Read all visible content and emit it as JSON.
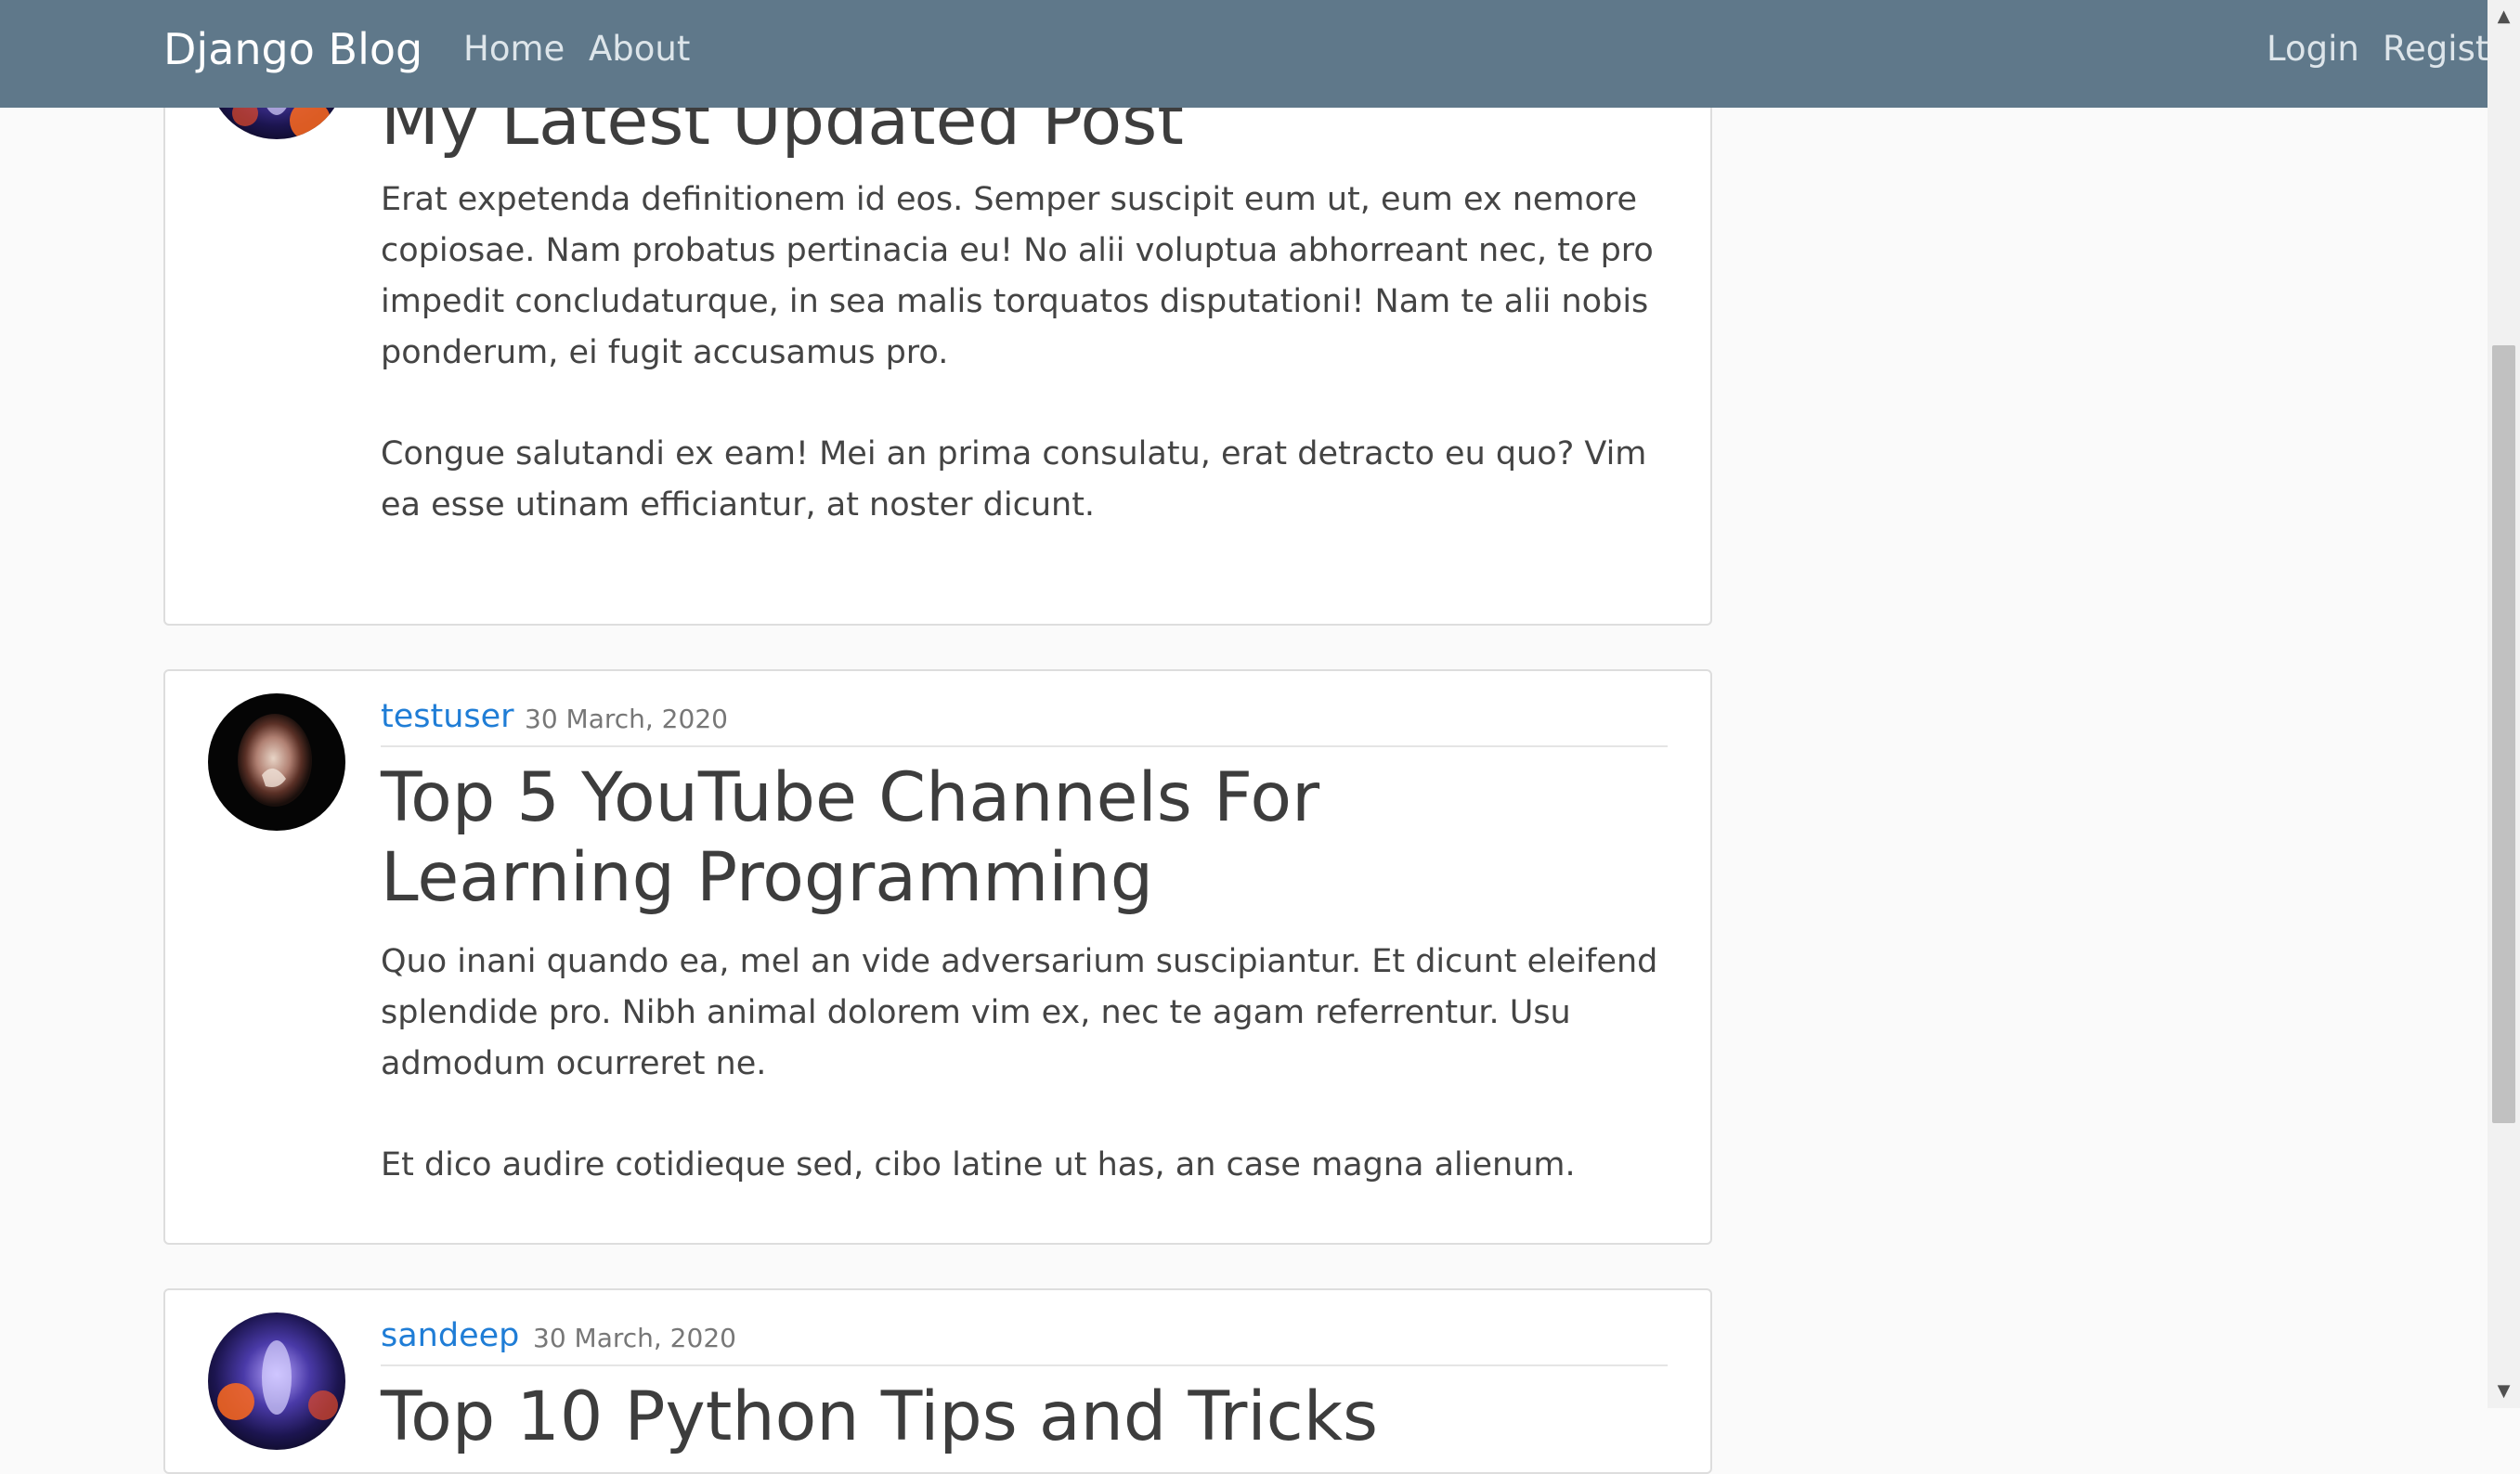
{
  "navbar": {
    "brand": "Django Blog",
    "links": [
      "Home",
      "About"
    ],
    "right_links": [
      "Login",
      "Register"
    ]
  },
  "posts": [
    {
      "author": "",
      "date": "",
      "title": "My Latest Updated Post",
      "paragraphs": [
        "Erat expetenda definitionem id eos. Semper suscipit eum ut, eum ex nemore copiosae. Nam probatus pertinacia eu! No alii voluptua abhorreant nec, te pro impedit concludaturque, in sea malis torquatos disputationi! Nam te alii nobis ponderum, ei fugit accusamus pro.",
        "Congue salutandi ex eam! Mei an prima consulatu, erat detracto eu quo? Vim ea esse utinam efficiantur, at noster dicunt."
      ]
    },
    {
      "author": "testuser",
      "date": "30 March, 2020",
      "title": "Top 5 YouTube Channels For Learning Programming",
      "paragraphs": [
        "Quo inani quando ea, mel an vide adversarium suscipiantur. Et dicunt eleifend splendide pro. Nibh animal dolorem vim ex, nec te agam referrentur. Usu admodum ocurreret ne.",
        "Et dico audire cotidieque sed, cibo latine ut has, an case magna alienum."
      ]
    },
    {
      "author": "sandeep",
      "date": "30 March, 2020",
      "title": "Top 10 Python Tips and Tricks",
      "paragraphs": []
    }
  ]
}
